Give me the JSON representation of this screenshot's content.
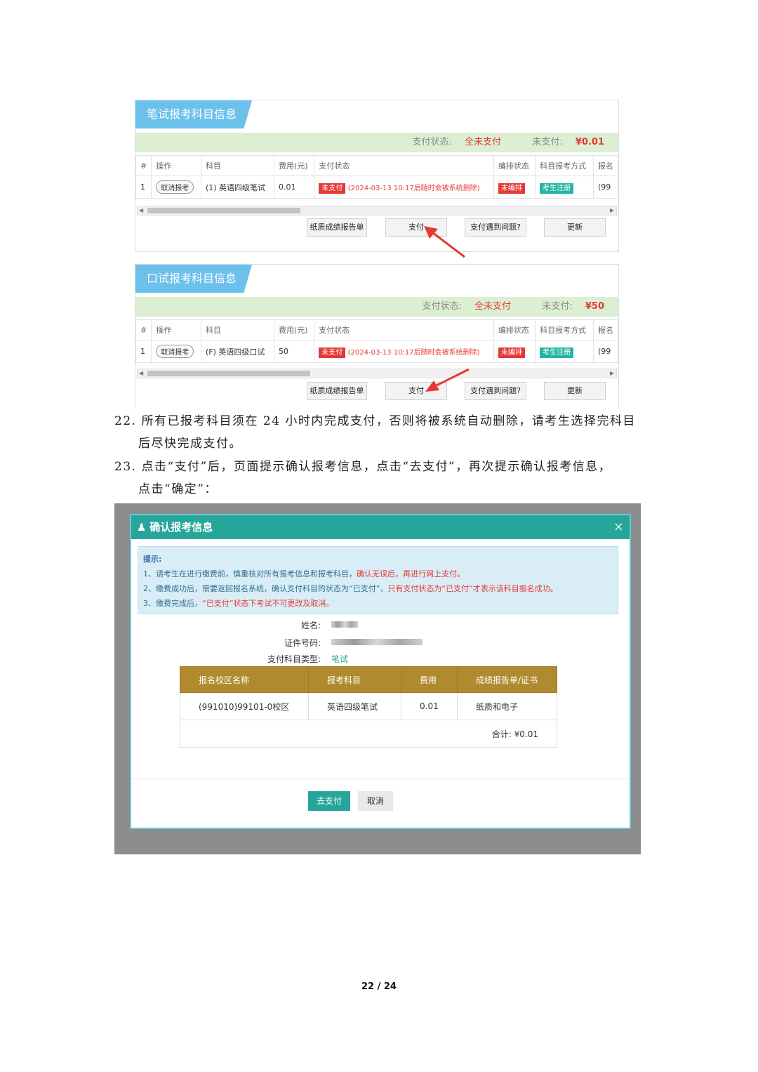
{
  "written": {
    "title": "笔试报考科目信息",
    "pay_status_label": "支付状态:",
    "pay_status_value": "全未支付",
    "unpaid_label": "未支付:",
    "unpaid_value": "¥0.01",
    "headers": [
      "#",
      "操作",
      "科目",
      "费用(元)",
      "支付状态",
      "编排状态",
      "科目报考方式",
      "报名"
    ],
    "row": {
      "num": "1",
      "action": "取消报考",
      "subject": "(1) 英语四级笔试",
      "fee": "0.01",
      "status_tag": "未支付",
      "status_note": "(2024-03-13 10:17后随时会被系统删除)",
      "arrange": "未编排",
      "method": "考生注册",
      "extra": "(99"
    },
    "buttons": [
      "纸质成绩报告单",
      "支付",
      "支付遇到问题?",
      "更新"
    ]
  },
  "oral": {
    "title": "口试报考科目信息",
    "pay_status_label": "支付状态:",
    "pay_status_value": "全未支付",
    "unpaid_label": "未支付:",
    "unpaid_value": "¥50",
    "headers": [
      "#",
      "操作",
      "科目",
      "费用(元)",
      "支付状态",
      "编排状态",
      "科目报考方式",
      "报名"
    ],
    "row": {
      "num": "1",
      "action": "取消报考",
      "subject": "(F) 英语四级口试",
      "fee": "50",
      "status_tag": "未支付",
      "status_note": "(2024-03-13 10:17后随时会被系统删除)",
      "arrange": "未编排",
      "method": "考生注册",
      "extra": "(99"
    },
    "buttons": [
      "纸质成绩报告单",
      "支付",
      "支付遇到问题?",
      "更新"
    ]
  },
  "steps": {
    "s22_line1": "22. 所有已报考科目须在 24 小时内完成支付，否则将被系统自动删除，请考生选择完科目",
    "s22_line2": "后尽快完成支付。",
    "s23_line1": "23. 点击“支付”后，页面提示确认报考信息，点击“去支付”，再次提示确认报考信息，",
    "s23_line2": "点击“确定”："
  },
  "dialog": {
    "title": "确认报考信息",
    "close": "×",
    "tip_title": "提示:",
    "tip1_a": "1、请考生在进行缴费前，慎重核对所有报考信息和报考科目，",
    "tip1_b": "确认无误后，再进行网上支付。",
    "tip2_a": "2、缴费成功后，需要返回报名系统，确认支付科目的状态为“已支付”，",
    "tip2_b": "只有支付状态为“已支付”才表示该科目报名成功。",
    "tip3_a": "3、缴费完成后，",
    "tip3_b": "“已支付”状态下考试不可更改及取消。",
    "name_label": "姓名:",
    "id_label": "证件号码:",
    "type_label": "支付科目类型:",
    "type_value": "笔试",
    "table_headers": [
      "报名校区名称",
      "报考科目",
      "费用",
      "成绩报告单/证书"
    ],
    "table_row": [
      "(991010)99101-0校区",
      "英语四级笔试",
      "0.01",
      "纸质和电子"
    ],
    "total": "合计: ¥0.01",
    "go_pay": "去支付",
    "cancel": "取消"
  },
  "page_number": "22 / 24"
}
